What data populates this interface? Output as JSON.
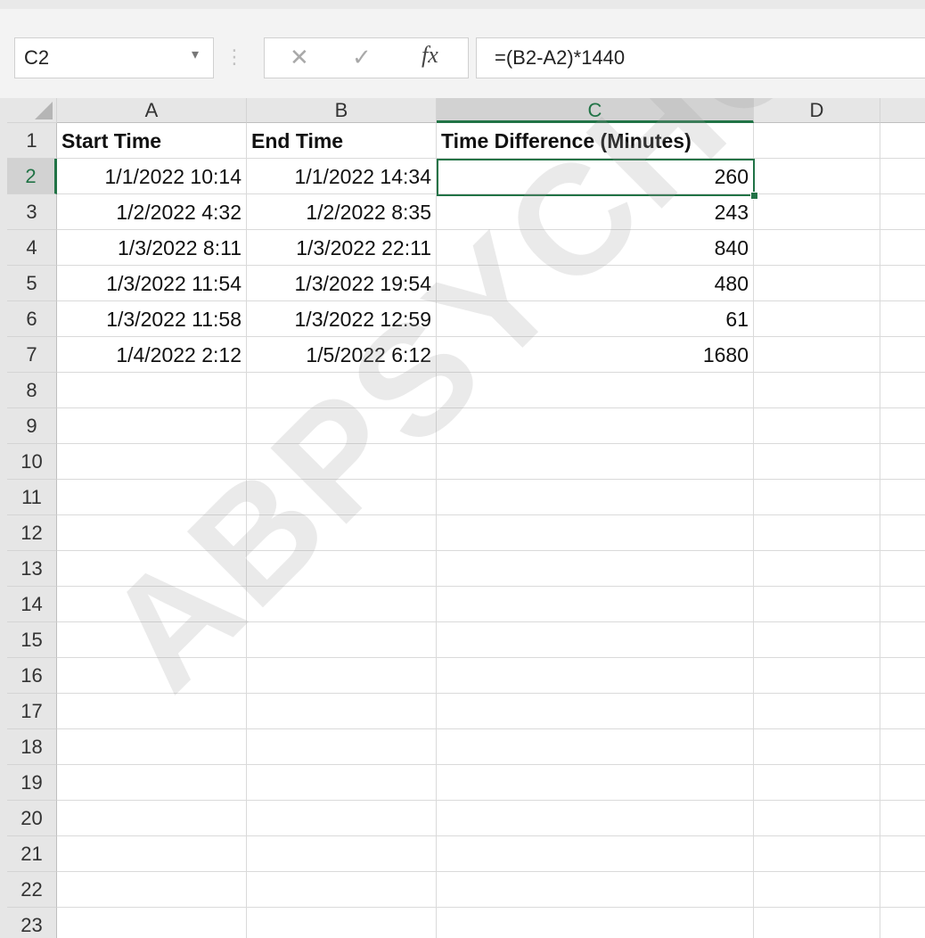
{
  "formula_bar": {
    "name_box": "C2",
    "name_caret": "▾",
    "separator": "⋮",
    "cancel_glyph": "✕",
    "enter_glyph": "✓",
    "fx_label": "fx",
    "formula": "=(B2-A2)*1440"
  },
  "columns": [
    "A",
    "B",
    "C",
    "D"
  ],
  "rows": [
    "1",
    "2",
    "3",
    "4",
    "5",
    "6",
    "7",
    "8",
    "9",
    "10",
    "11",
    "12",
    "13",
    "14",
    "15",
    "16",
    "17",
    "18",
    "19",
    "20",
    "21",
    "22",
    "23"
  ],
  "cells": {
    "r1": [
      "Start Time",
      "End Time",
      "Time Difference (Minutes)"
    ],
    "r2": [
      "1/1/2022 10:14",
      "1/1/2022 14:34",
      "260"
    ],
    "r3": [
      "1/2/2022 4:32",
      "1/2/2022 8:35",
      "243"
    ],
    "r4": [
      "1/3/2022 8:11",
      "1/3/2022 22:11",
      "840"
    ],
    "r5": [
      "1/3/2022 11:54",
      "1/3/2022 19:54",
      "480"
    ],
    "r6": [
      "1/3/2022 11:58",
      "1/3/2022 12:59",
      "61"
    ],
    "r7": [
      "1/4/2022 2:12",
      "1/5/2022 6:12",
      "1680"
    ]
  },
  "watermark": "ABPSYCHOLOGY.CO",
  "colors": {
    "accent": "#217346",
    "header_bg": "#e6e6e6",
    "selected_header_bg": "#d2d2d2"
  }
}
